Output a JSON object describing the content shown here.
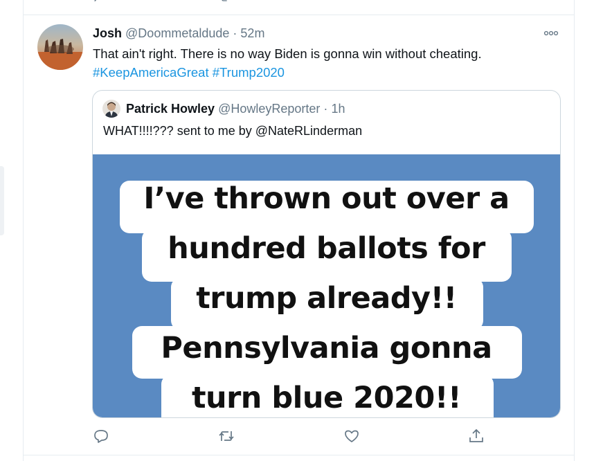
{
  "tweet": {
    "author": {
      "name": "Josh",
      "handle": "@Doommetaldude",
      "separator": "·",
      "time": "52m"
    },
    "text_plain": "That ain't right. There is no way Biden is gonna win without cheating.",
    "hashtags": [
      "#KeepAmericaGreat",
      "#Trump2020"
    ],
    "quoted": {
      "author": {
        "name": "Patrick Howley",
        "handle": "@HowleyReporter",
        "separator": "·",
        "time": "1h"
      },
      "text": "WHAT!!!!??? sent to me by @NateRLinderman",
      "image_lines": [
        "I’ve thrown out over a",
        "hundred ballots for",
        "trump already!!",
        "Pennsylvania gonna",
        "turn blue 2020!!"
      ],
      "image_bg_color": "#5a8ac2"
    },
    "actions": [
      "reply-icon",
      "retweet-icon",
      "like-icon",
      "share-icon"
    ]
  },
  "colors": {
    "link": "#1b95e0",
    "secondary_text": "#657786",
    "border": "#e6ecf0"
  }
}
